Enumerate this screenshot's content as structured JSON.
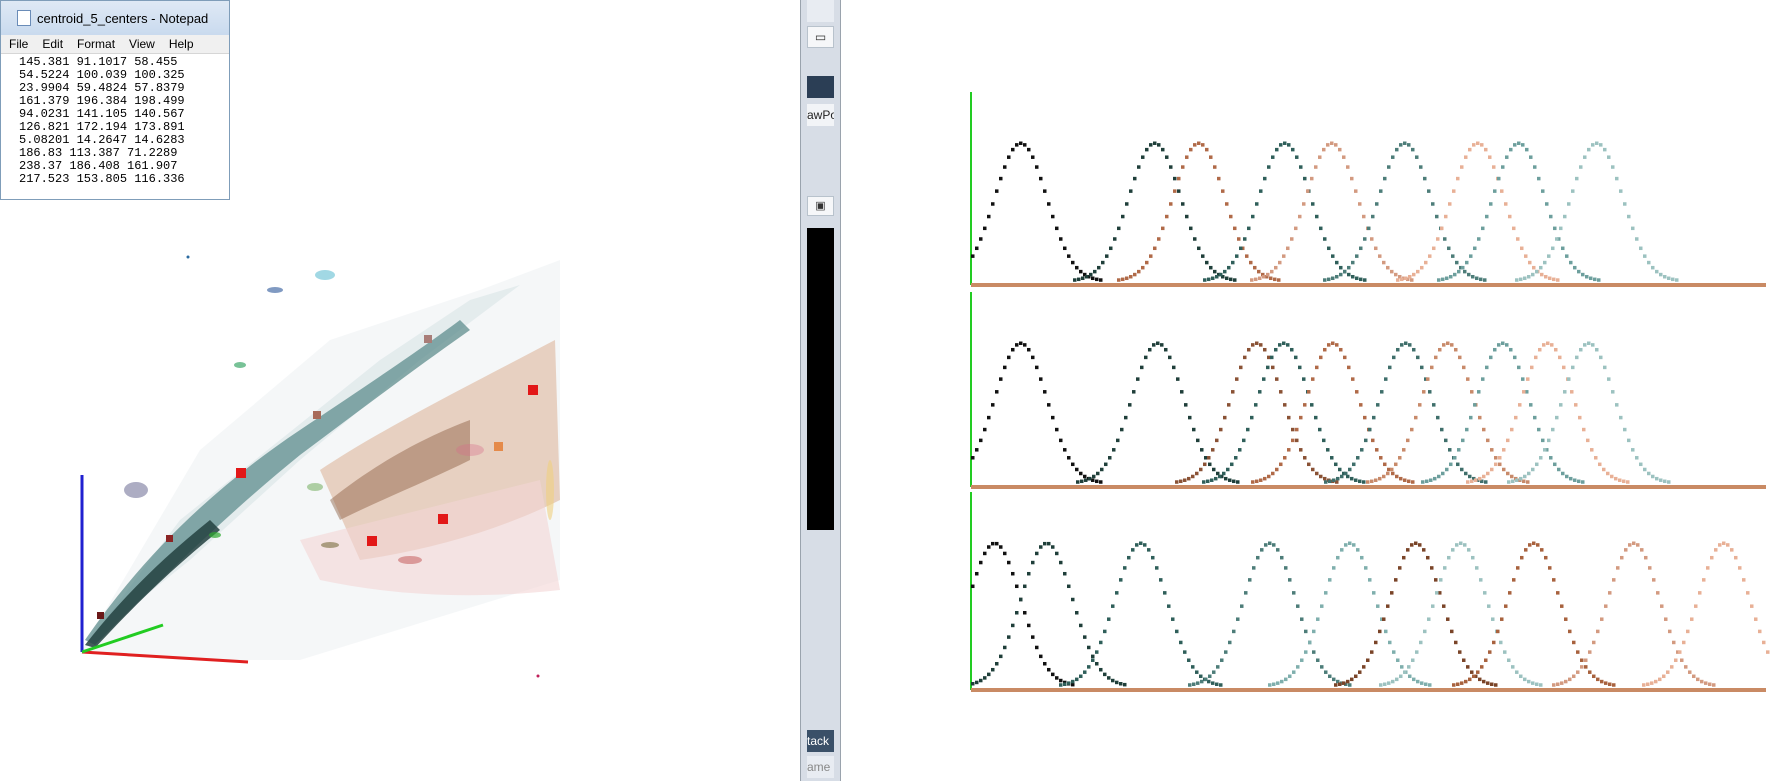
{
  "notepad": {
    "title": "centroid_5_centers - Notepad",
    "menu": [
      "File",
      "Edit",
      "Format",
      "View",
      "Help"
    ],
    "lines": [
      "145.381 91.1017 58.455",
      "54.5224 100.039 100.325",
      "23.9904 59.4824 57.8379",
      "161.379 196.384 198.499",
      "94.0231 141.105 140.567",
      "126.821 172.194 173.891",
      "5.08201 14.2647 14.6283",
      "186.83 113.387 71.2289",
      "238.37 186.408 161.907",
      "217.523 153.805 116.336"
    ]
  },
  "taskbar_fragments": {
    "top_label": "awPo",
    "stack_label": "tack",
    "bottom_label": "ame"
  },
  "colors": {
    "axis_green": "#22cc22",
    "axis_red": "#e02020",
    "axis_blue": "#2020d0",
    "centroid_red": "#e21818",
    "baseline": "#c98a64"
  },
  "icons": [
    "document-icon",
    "window-icon",
    "window-control-icon"
  ]
}
